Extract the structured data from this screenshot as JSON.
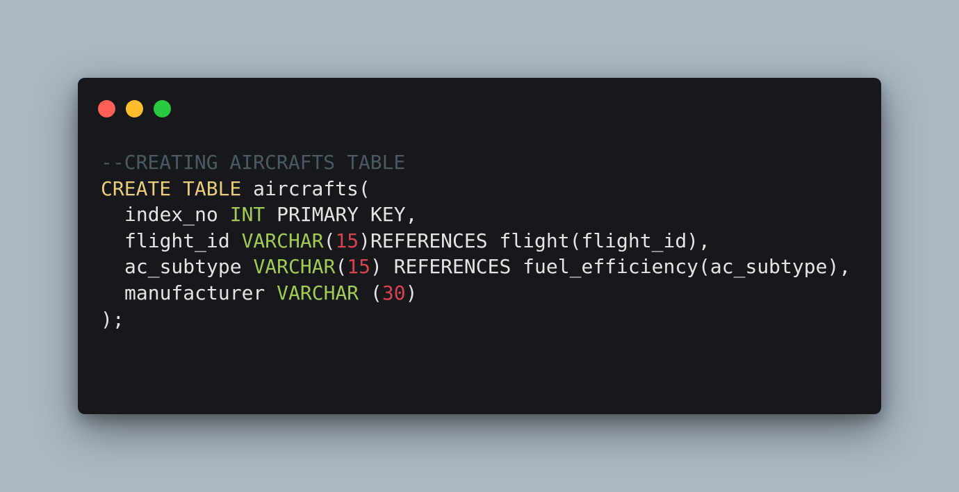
{
  "window": {
    "buttons": {
      "close_color": "#ff5f57",
      "minimize_color": "#febc2e",
      "maximize_color": "#28c840"
    }
  },
  "colors": {
    "background": "#abb8c3",
    "window_bg": "#17181b",
    "comment": "#4b5a60",
    "keyword": "#e8cd7a",
    "type": "#a3c957",
    "number": "#d8434f",
    "plain": "#e4e4e4"
  },
  "code": {
    "line1": {
      "comment": "--CREATING AIRCRAFTS TABLE"
    },
    "line2": {
      "kw": "CREATE TABLE",
      "rest": " aircrafts("
    },
    "line3": {
      "name": "index_no ",
      "type": "INT",
      "rest": " PRIMARY KEY,"
    },
    "line4": {
      "name": "flight_id ",
      "type": "VARCHAR",
      "open": "(",
      "num": "15",
      "rest": ")REFERENCES flight(flight_id),"
    },
    "line5": {
      "name": "ac_subtype ",
      "type": "VARCHAR",
      "open": "(",
      "num": "15",
      "rest": ") REFERENCES fuel_efficiency(ac_subtype),"
    },
    "line6": {
      "name": "manufacturer ",
      "type": "VARCHAR",
      "open": " (",
      "num": "30",
      "rest": ")"
    },
    "line7": {
      "text": ");"
    }
  }
}
